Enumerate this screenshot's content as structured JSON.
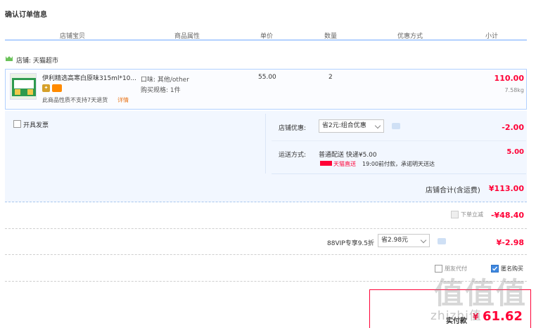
{
  "page_title": "确认订单信息",
  "headers": {
    "shop_item": "店铺宝贝",
    "attrs": "商品属性",
    "unit_price": "单价",
    "qty": "数量",
    "discount": "优惠方式",
    "subtotal": "小计"
  },
  "shop": {
    "label": "店铺: 天猫超市"
  },
  "product": {
    "name": "伊利精选高寒白原味315ml*10...",
    "notice": "此商品性质不支持7天退货",
    "detail_link": "详情",
    "flavor": "口味: 其他/other",
    "spec": "购买规格: 1件",
    "unit_price": "55.00",
    "qty": "2",
    "subtotal": "110.00",
    "weight": "7.58kg"
  },
  "invoice": {
    "label": "开具发票"
  },
  "store_discount": {
    "label": "店铺优惠:",
    "selected": "省2元:组合优惠",
    "amount": "-2.00"
  },
  "shipping": {
    "label": "运送方式:",
    "method": "普通配送 快递¥5.00",
    "carrier": "天猫直送",
    "eta": "19:00前付款，承诺明天送达",
    "amount": "5.00"
  },
  "shop_total": {
    "label": "店铺合计(含运费)",
    "amount": "¥113.00"
  },
  "instant_discount": {
    "label": "下单立减",
    "amount": "-¥48.40"
  },
  "vip": {
    "label": "88VIP专享9.5折",
    "selected": "省2.98元",
    "amount": "¥-2.98"
  },
  "options": {
    "friend_pay": "朋友代付",
    "anonymous": "匿名购买"
  },
  "final": {
    "label": "实付款",
    "amount": "61.62"
  },
  "watermark": {
    "logo": "值值值",
    "url": "zhizhi值"
  }
}
